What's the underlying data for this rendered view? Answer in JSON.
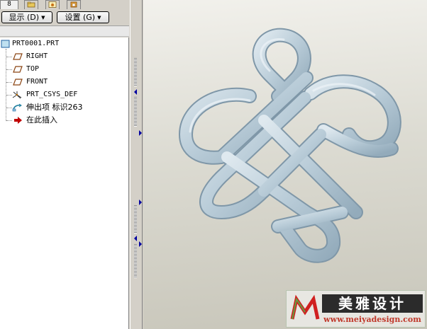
{
  "tabs": [
    {
      "label": "8",
      "icon": "model-tree-icon",
      "active": true
    },
    {
      "label": "",
      "icon": "folder-browser-icon"
    },
    {
      "label": "",
      "icon": "favorites-icon"
    },
    {
      "label": "",
      "icon": "layers-icon"
    }
  ],
  "menu": {
    "display_label": "显示 (D)",
    "settings_label": "设置 (G)"
  },
  "tree": {
    "root": "PRT0001.PRT",
    "items": [
      {
        "label": "RIGHT",
        "icon": "datum-plane-icon"
      },
      {
        "label": "TOP",
        "icon": "datum-plane-icon"
      },
      {
        "label": "FRONT",
        "icon": "datum-plane-icon"
      },
      {
        "label": "PRT_CSYS_DEF",
        "icon": "coordinate-system-icon"
      },
      {
        "label": "伸出项 标识263",
        "icon": "protrusion-feature-icon"
      },
      {
        "label": "在此插入",
        "icon": "insert-here-arrow-icon"
      }
    ]
  },
  "colors": {
    "knot_fill": "#c7d7e2",
    "knot_edge": "#7f97a8",
    "insert_arrow": "#c00000",
    "datum_plane": "#8b4513"
  },
  "watermark": {
    "title": "美雅设计",
    "url": "www.meiyadesign.com"
  }
}
